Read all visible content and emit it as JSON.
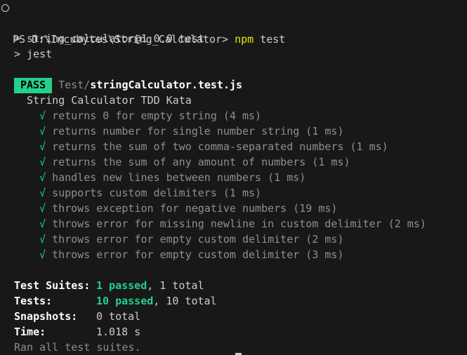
{
  "prompt": {
    "ps": "PS ",
    "path": "D:\\Incubytes\\String_Calculator> ",
    "command": "npm",
    "args": " test"
  },
  "run_lines": [
    "> string_calculator@1.0.0 test",
    "> jest"
  ],
  "result": {
    "badge": "PASS",
    "dir": "Test/",
    "file": "stringCalculator.test.js",
    "suite": "String Calculator TDD Kata"
  },
  "tests": [
    {
      "check": "√",
      "name": "returns 0 for empty string",
      "time": "(4 ms)"
    },
    {
      "check": "√",
      "name": "returns number for single number string",
      "time": "(1 ms)"
    },
    {
      "check": "√",
      "name": "returns the sum of two comma-separated numbers",
      "time": "(1 ms)"
    },
    {
      "check": "√",
      "name": "returns the sum of any amount of numbers",
      "time": "(1 ms)"
    },
    {
      "check": "√",
      "name": "handles new lines between numbers",
      "time": "(1 ms)"
    },
    {
      "check": "√",
      "name": "supports custom delimiters",
      "time": "(1 ms)"
    },
    {
      "check": "√",
      "name": "throws exception for negative numbers",
      "time": "(19 ms)"
    },
    {
      "check": "√",
      "name": "throws error for missing newline in custom delimiter",
      "time": "(2 ms)"
    },
    {
      "check": "√",
      "name": "throws error for empty custom delimiter",
      "time": "(2 ms)"
    },
    {
      "check": "√",
      "name": "throws error for empty custom delimiter",
      "time": "(3 ms)"
    }
  ],
  "summary": {
    "suites_label": "Test Suites:",
    "suites_passed": "1 passed",
    "suites_total": ", 1 total",
    "tests_label": "Tests:",
    "tests_passed": "10 passed",
    "tests_total": ", 10 total",
    "snapshots_label": "Snapshots:",
    "snapshots_value": "0 total",
    "time_label": "Time:",
    "time_value": "1.018 s",
    "footer": "Ran all test suites."
  },
  "colors": {
    "background": "#181818",
    "foreground": "#cccccc",
    "pass_green": "#23d18b",
    "command_yellow": "#e5e510",
    "dim_gray": "#8b8b8b"
  }
}
